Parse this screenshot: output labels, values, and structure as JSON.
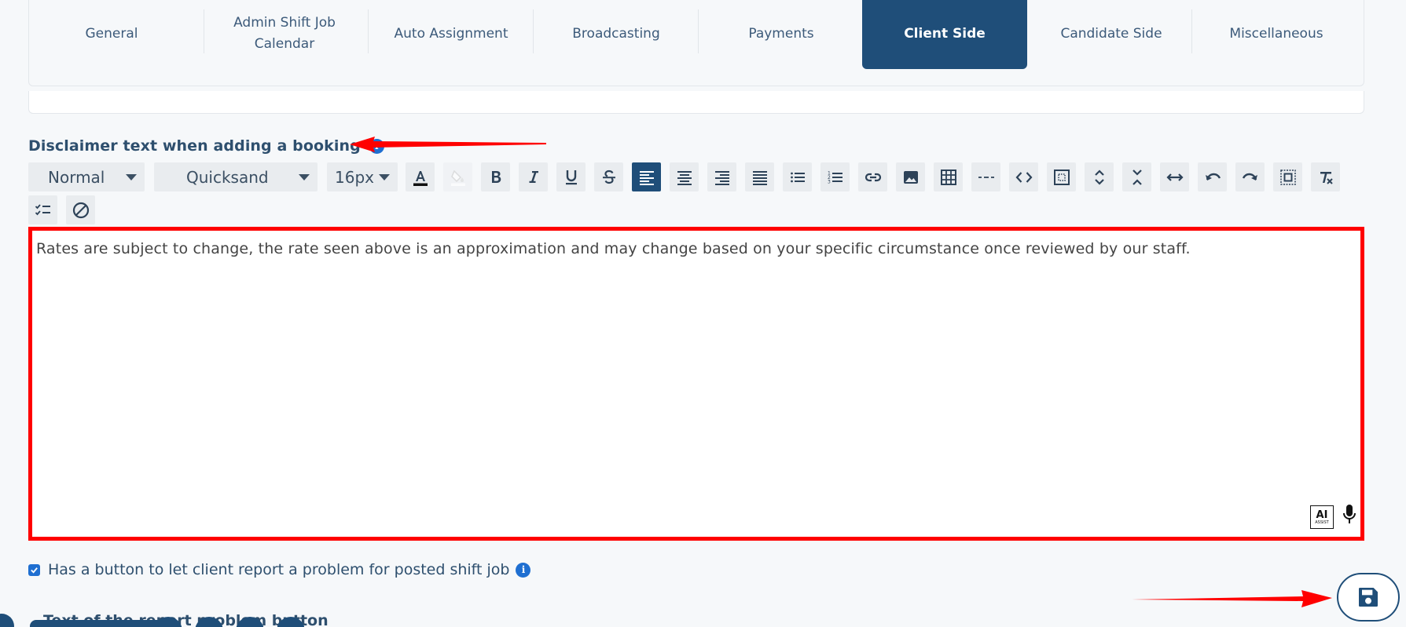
{
  "tabs": [
    {
      "label": "General",
      "active": false
    },
    {
      "label": "Admin Shift Job Calendar",
      "active": false
    },
    {
      "label": "Auto Assignment",
      "active": false
    },
    {
      "label": "Broadcasting",
      "active": false
    },
    {
      "label": "Payments",
      "active": false
    },
    {
      "label": "Client Side",
      "active": true
    },
    {
      "label": "Candidate Side",
      "active": false
    },
    {
      "label": "Miscellaneous",
      "active": false
    }
  ],
  "disclaimer": {
    "label": "Disclaimer text when adding a booking",
    "info_icon": "info-icon"
  },
  "toolbar": {
    "heading_select": "Normal",
    "font_select": "Quicksand",
    "size_select": "16px"
  },
  "editor": {
    "content": "Rates are subject to change, the rate seen above is an approximation and may change based on your specific circumstance once reviewed by our staff.",
    "ai_badge": "AI",
    "ai_badge_sub": "ASSIST"
  },
  "report_problem": {
    "checked": true,
    "label": "Has a button to let client report a problem for posted shift job"
  },
  "next_field_label": "Text of the report problem button",
  "colors": {
    "accent": "#1f4e79",
    "info": "#1f6fd1",
    "annotation": "#ff0000"
  }
}
